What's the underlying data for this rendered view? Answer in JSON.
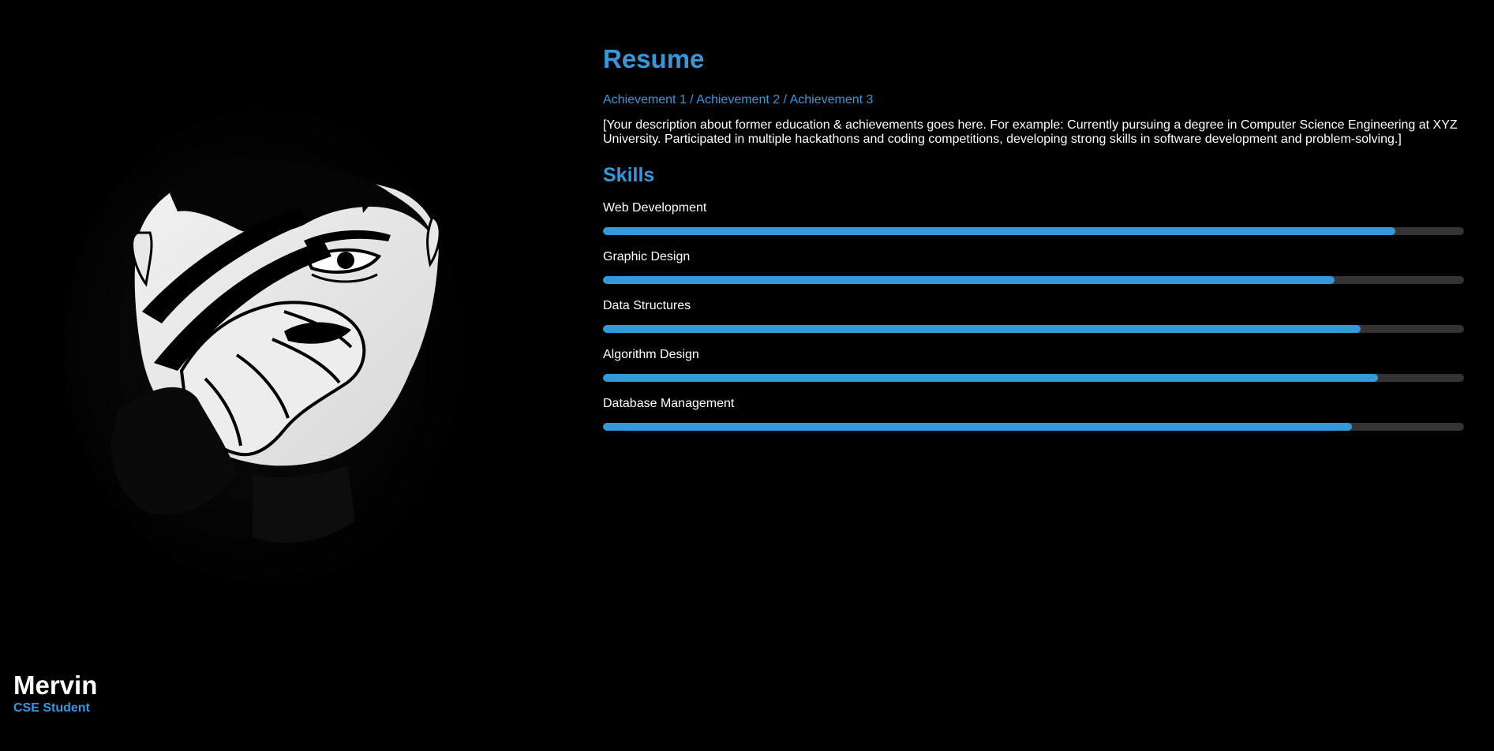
{
  "profile": {
    "name": "Mervin",
    "role": "CSE Student"
  },
  "resume": {
    "title": "Resume",
    "achievements": "Achievement 1 / Achievement 2 / Achievement 3",
    "description": "[Your description about former education & achievements goes here. For example: Currently pursuing a degree in Computer Science Engineering at XYZ University. Participated in multiple hackathons and coding competitions, developing strong skills in software development and problem-solving.]"
  },
  "skills": {
    "title": "Skills",
    "items": [
      {
        "label": "Web Development",
        "level": 0.92
      },
      {
        "label": "Graphic Design",
        "level": 0.85
      },
      {
        "label": "Data Structures",
        "level": 0.88
      },
      {
        "label": "Algorithm Design",
        "level": 0.9
      },
      {
        "label": "Database Management",
        "level": 0.87
      }
    ]
  },
  "colors": {
    "background": "#000000",
    "accent": "#3498db",
    "track": "#333333",
    "text": "#ffffff"
  },
  "icons": {
    "portrait": "illustrated-face-portrait"
  }
}
